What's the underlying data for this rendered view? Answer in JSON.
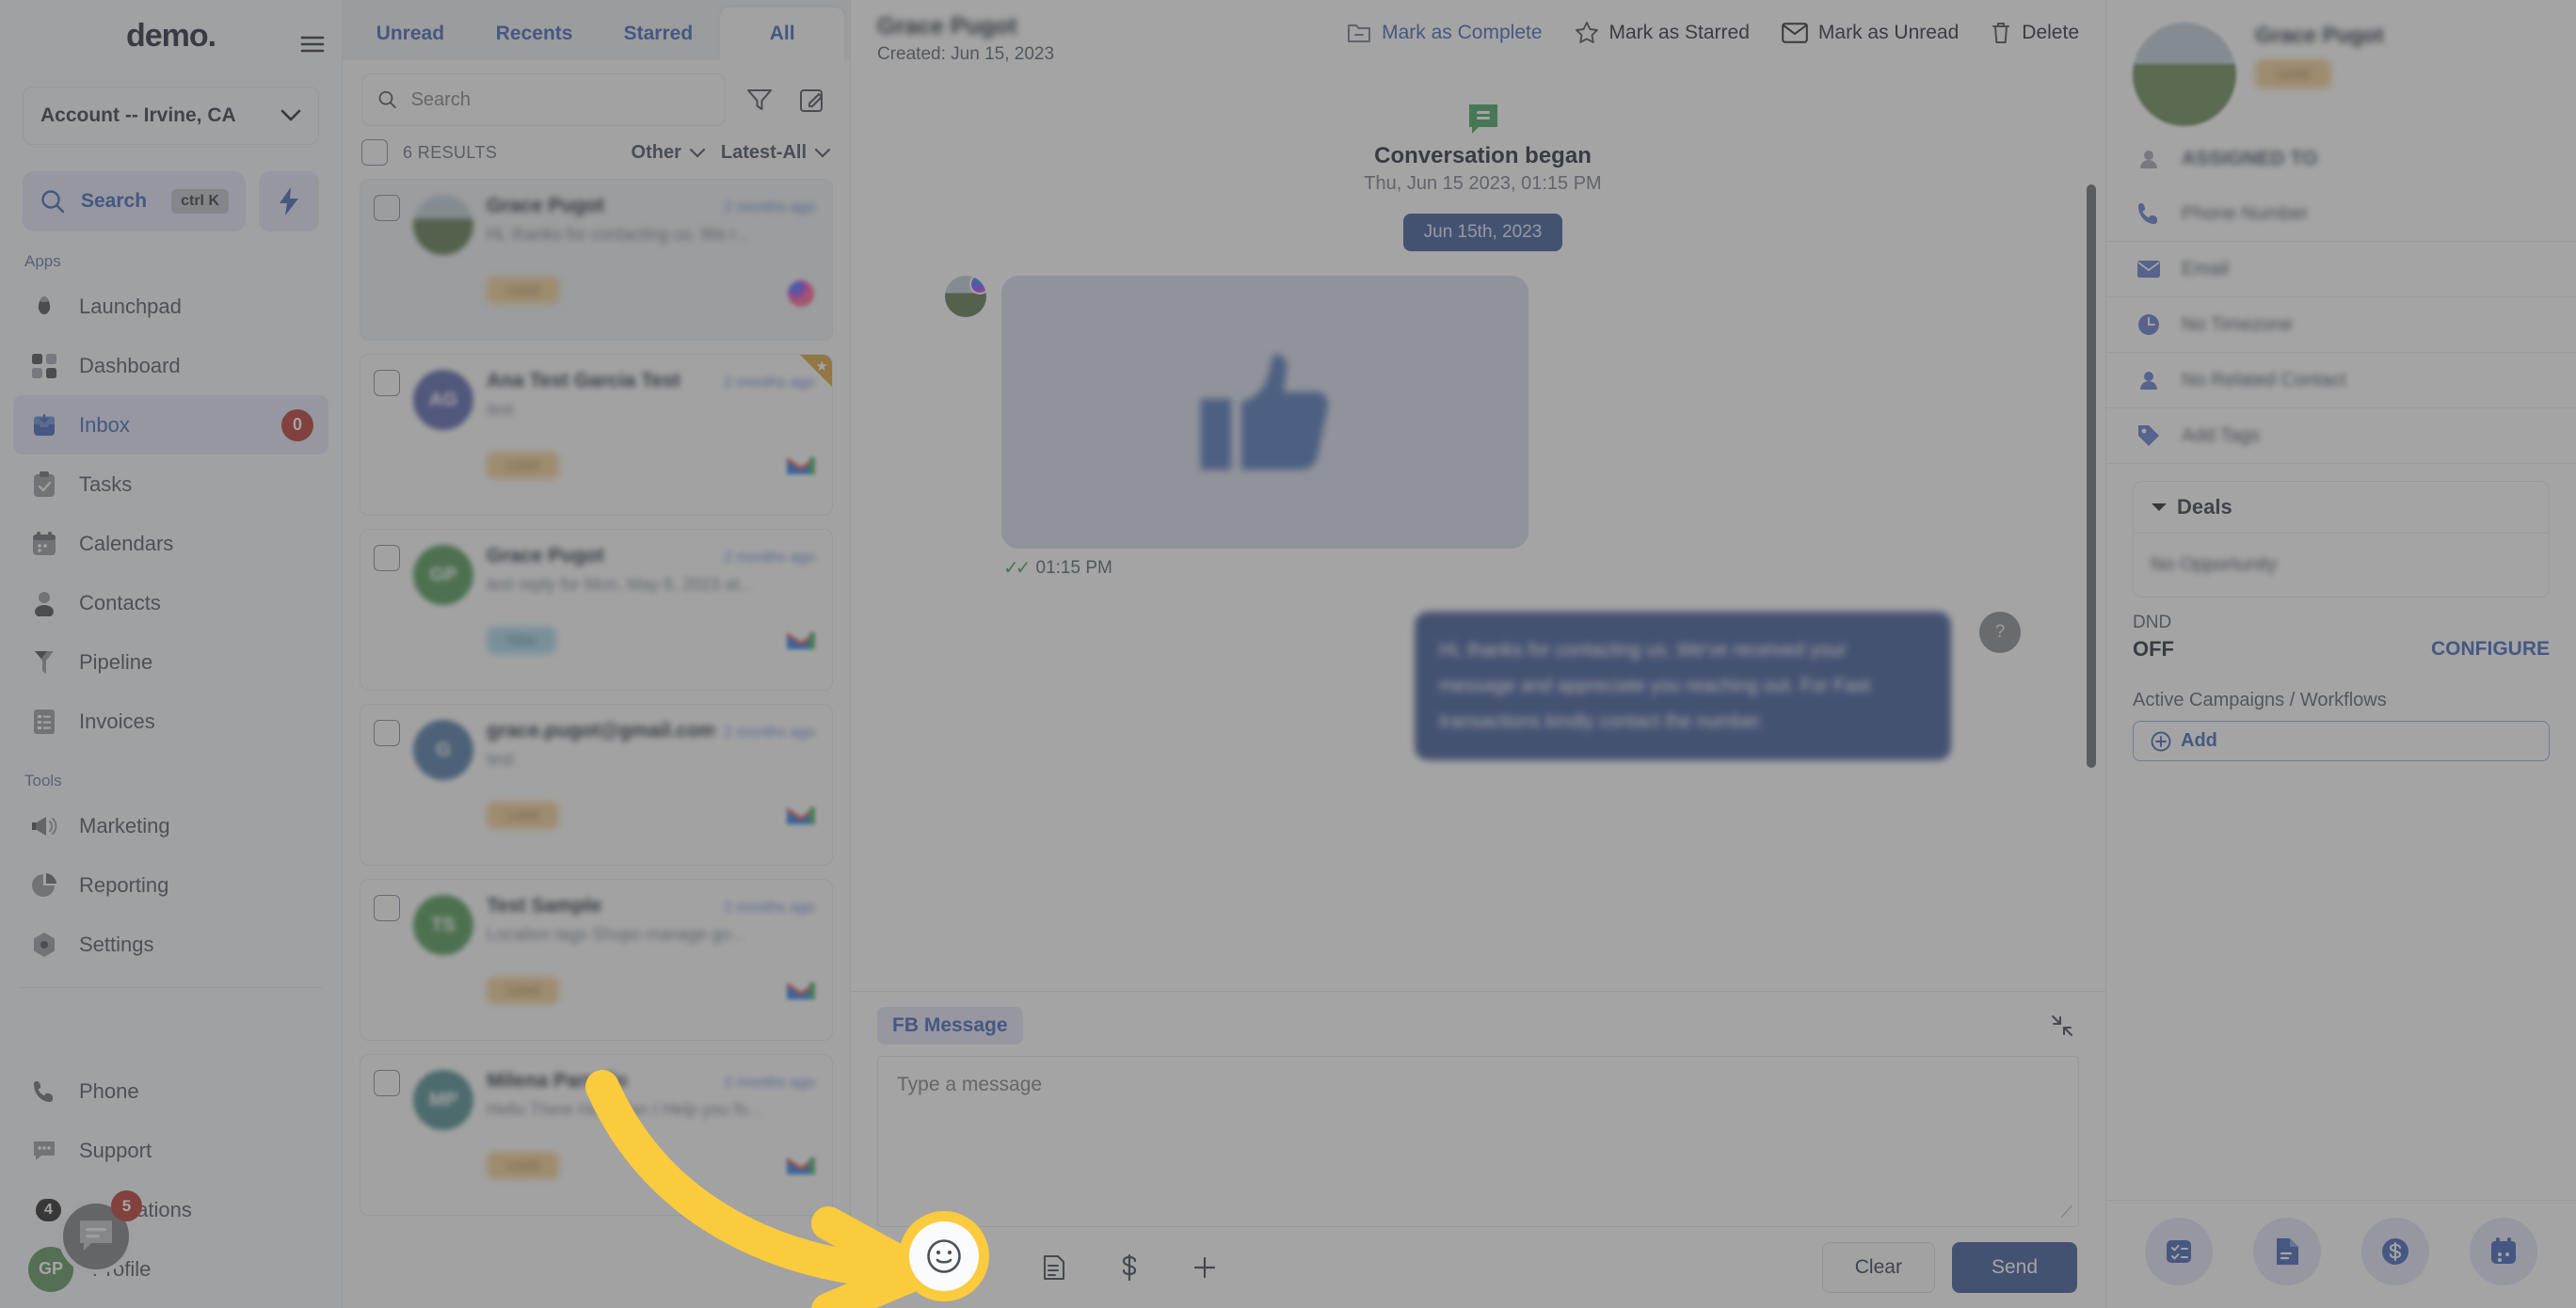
{
  "sidebar": {
    "brand": "demo.",
    "collapse_icon": "collapse-menu-icon",
    "account_selector": {
      "label": "Account -- Irvine, CA",
      "chevron": "chevron-down-icon"
    },
    "search": {
      "label": "Search",
      "shortcut": "ctrl K",
      "icon": "search-icon"
    },
    "quick_action_icon": "lightning-bolt-icon",
    "groups": [
      {
        "label": "Apps",
        "items": [
          {
            "label": "Launchpad",
            "icon": "launchpad-icon",
            "active": false,
            "badge": ""
          },
          {
            "label": "Dashboard",
            "icon": "dashboard-grid-icon",
            "active": false,
            "badge": ""
          },
          {
            "label": "Inbox",
            "icon": "inbox-tray-icon",
            "active": true,
            "badge": "0"
          },
          {
            "label": "Tasks",
            "icon": "clipboard-check-icon",
            "active": false,
            "badge": ""
          },
          {
            "label": "Calendars",
            "icon": "calendar-icon",
            "active": false,
            "badge": ""
          },
          {
            "label": "Contacts",
            "icon": "person-icon",
            "active": false,
            "badge": ""
          },
          {
            "label": "Pipeline",
            "icon": "funnel-pipeline-icon",
            "active": false,
            "badge": ""
          },
          {
            "label": "Invoices",
            "icon": "invoice-list-icon",
            "active": false,
            "badge": ""
          }
        ]
      },
      {
        "label": "Tools",
        "items": [
          {
            "label": "Marketing",
            "icon": "megaphone-icon",
            "active": false,
            "badge": ""
          },
          {
            "label": "Reporting",
            "icon": "pie-chart-icon",
            "active": false,
            "badge": ""
          },
          {
            "label": "Settings",
            "icon": "gear-icon",
            "active": false,
            "badge": ""
          }
        ]
      },
      {
        "label": "",
        "items": [
          {
            "label": "Phone",
            "icon": "phone-icon",
            "active": false,
            "badge": ""
          },
          {
            "label": "Support",
            "icon": "support-chat-icon",
            "active": false,
            "badge": ""
          },
          {
            "label": "Notifications",
            "icon": "bell-icon",
            "active": false,
            "badge": ""
          },
          {
            "label": "Profile",
            "icon": "avatar-icon",
            "active": false,
            "badge": ""
          }
        ]
      }
    ],
    "profile_initials": "GP",
    "chat_fab": {
      "icon": "chat-bubble-icon",
      "badge_dark": "4",
      "badge_red": "5"
    }
  },
  "conversation_list": {
    "tabs": [
      {
        "label": "Unread",
        "active": false
      },
      {
        "label": "Recents",
        "active": false
      },
      {
        "label": "Starred",
        "active": false
      },
      {
        "label": "All",
        "active": true
      }
    ],
    "search_placeholder": "Search",
    "search_value": "",
    "filter_icon": "filter-funnel-icon",
    "compose_icon": "compose-pencil-icon",
    "results_count": "6 RESULTS",
    "type_filter": "Other",
    "sort_filter": "Latest-All",
    "items": [
      {
        "name": "Grace Pugot",
        "time": "2 months ago",
        "preview": "Hi, thanks for contacting us. We r...",
        "tag": "Lead",
        "avatar_color": "#4e6b3d",
        "initials": "",
        "channel_icon": "messenger-icon",
        "starred": false,
        "selected": true
      },
      {
        "name": "Ana Test Garcia Test",
        "time": "2 months ago",
        "preview": "test",
        "tag": "Lead",
        "avatar_color": "#4a56a6",
        "initials": "AG",
        "channel_icon": "gmail-icon",
        "starred": true,
        "selected": false
      },
      {
        "name": "Grace Pugot",
        "time": "2 months ago",
        "preview": "test reply for Mon, May 8, 2023 at...",
        "tag": "New",
        "avatar_color": "#3f8f46",
        "initials": "GP",
        "channel_icon": "gmail-icon",
        "starred": false,
        "selected": false
      },
      {
        "name": "grace.pugot@gmail.com",
        "time": "2 months ago",
        "preview": "test",
        "tag": "Lead",
        "avatar_color": "#3f6d9e",
        "initials": "G",
        "channel_icon": "gmail-icon",
        "starred": false,
        "selected": false
      },
      {
        "name": "Test Sample",
        "time": "2 months ago",
        "preview": "Location tags Shopo manage go...",
        "tag": "Lead",
        "avatar_color": "#3f8f46",
        "initials": "TS",
        "channel_icon": "gmail-icon",
        "starred": false,
        "selected": false
      },
      {
        "name": "Milena Parrello",
        "time": "2 months ago",
        "preview": "Hello There How Can I Help you fo...",
        "tag": "Lead",
        "avatar_color": "#3f8286",
        "initials": "MP",
        "channel_icon": "gmail-icon",
        "starred": false,
        "selected": false
      }
    ]
  },
  "main": {
    "contact_name": "Grace Pugot",
    "created_label": "Created: Jun 15, 2023",
    "actions": [
      {
        "label": "Mark as Complete",
        "icon": "folder-complete-icon",
        "accent": true
      },
      {
        "label": "Mark as Starred",
        "icon": "star-outline-icon",
        "accent": false
      },
      {
        "label": "Mark as Unread",
        "icon": "envelope-icon",
        "accent": false
      },
      {
        "label": "Delete",
        "icon": "trash-icon",
        "accent": false
      }
    ],
    "conversation_began": {
      "icon": "green-chat-icon",
      "title": "Conversation began",
      "subtitle": "Thu, Jun 15 2023, 01:15 PM"
    },
    "date_chip": "Jun 15th, 2023",
    "messages": [
      {
        "direction": "in",
        "type": "sticker",
        "sticker": "thumbs-up-sticker",
        "time": "01:15 PM",
        "status_icon": "double-check-icon",
        "channel_icon": "messenger-icon"
      },
      {
        "direction": "out",
        "type": "text",
        "text": "Hi, thanks for contacting us. We've received your message and appreciate you reaching out.\nFor Fast transactions kindly contact the number.",
        "avatar_initial": "?",
        "channel_icon": "messenger-icon"
      }
    ]
  },
  "composer": {
    "channel_chip": "FB Message",
    "expand_icon": "collapse-expand-icon",
    "placeholder": "Type a message",
    "value": "",
    "tools": [
      {
        "icon": "attachment-paperclip-icon",
        "name": "attach"
      },
      {
        "icon": "emoji-smiley-icon",
        "name": "emoji",
        "highlighted": true
      },
      {
        "icon": "template-snippet-icon",
        "name": "template"
      },
      {
        "icon": "dollar-payment-icon",
        "name": "payment"
      },
      {
        "icon": "plus-more-icon",
        "name": "more"
      }
    ],
    "clear_label": "Clear",
    "send_label": "Send"
  },
  "right_panel": {
    "contact_name": "Grace Pugot",
    "contact_tag": "Lead",
    "assigned_to_label": "ASSIGNED TO",
    "assigned_to_icon": "person-icon",
    "fields": [
      {
        "icon": "phone-icon",
        "label": "Phone Number"
      },
      {
        "icon": "envelope-icon",
        "label": "Email"
      },
      {
        "icon": "clock-timezone-icon",
        "label": "No Timezone"
      },
      {
        "icon": "related-contact-icon",
        "label": "No Related Contact"
      },
      {
        "icon": "tag-icon",
        "label": "Add Tags"
      }
    ],
    "deals": {
      "title": "Deals",
      "caret": "caret-down-icon",
      "body": "No Opportunity"
    },
    "dnd": {
      "label": "DND",
      "value": "OFF",
      "configure": "CONFIGURE"
    },
    "campaigns": {
      "label": "Active Campaigns / Workflows",
      "add_label": "Add",
      "add_icon": "plus-circle-icon"
    },
    "quick_actions": [
      {
        "icon": "task-checklist-icon",
        "name": "tasks"
      },
      {
        "icon": "document-icon",
        "name": "documents"
      },
      {
        "icon": "dollar-circle-icon",
        "name": "payments"
      },
      {
        "icon": "calendar-icon",
        "name": "appointments"
      }
    ]
  },
  "annotation": {
    "arrow": "curved-yellow-arrow",
    "spotlight_target": "emoji-smiley-icon"
  }
}
